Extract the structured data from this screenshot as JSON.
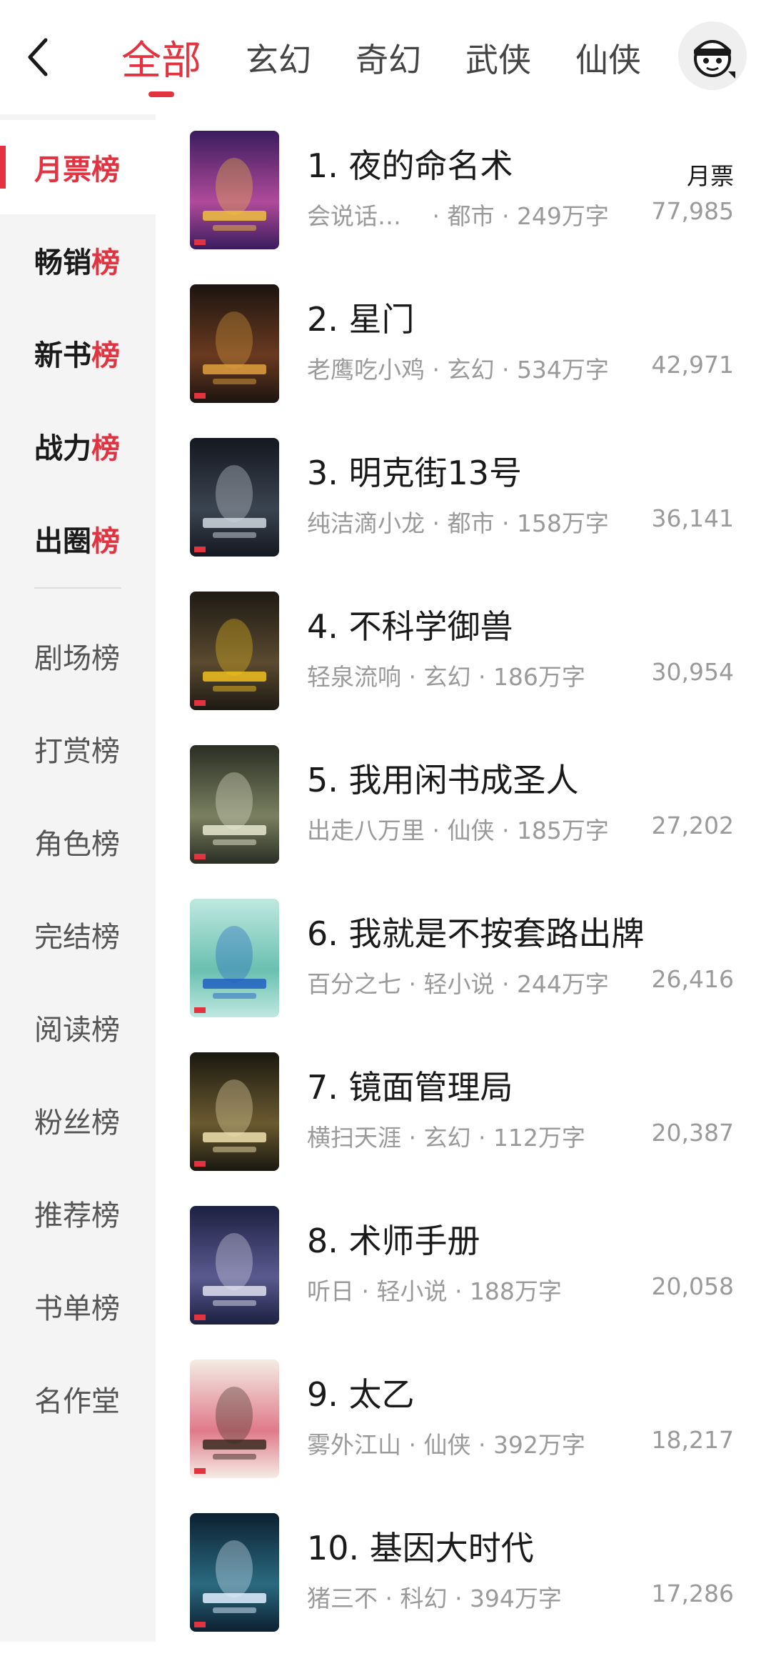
{
  "header": {
    "tabs": [
      {
        "label": "全部",
        "active": true
      },
      {
        "label": "玄幻"
      },
      {
        "label": "奇幻"
      },
      {
        "label": "武侠"
      },
      {
        "label": "仙侠"
      }
    ]
  },
  "sidebar": {
    "items": [
      {
        "pre": "月票",
        "suf": "榜",
        "style": "active"
      },
      {
        "pre": "畅销",
        "suf": "榜",
        "style": "primary"
      },
      {
        "pre": "新书",
        "suf": "榜",
        "style": "primary"
      },
      {
        "pre": "战力",
        "suf": "榜",
        "style": "primary"
      },
      {
        "pre": "出圈",
        "suf": "榜",
        "style": "primary"
      },
      {
        "pre": "剧场榜",
        "suf": "",
        "style": "normal"
      },
      {
        "pre": "打赏榜",
        "suf": "",
        "style": "normal"
      },
      {
        "pre": "角色榜",
        "suf": "",
        "style": "normal"
      },
      {
        "pre": "完结榜",
        "suf": "",
        "style": "normal"
      },
      {
        "pre": "阅读榜",
        "suf": "",
        "style": "normal"
      },
      {
        "pre": "粉丝榜",
        "suf": "",
        "style": "normal"
      },
      {
        "pre": "推荐榜",
        "suf": "",
        "style": "normal"
      },
      {
        "pre": "书单榜",
        "suf": "",
        "style": "normal"
      },
      {
        "pre": "名作堂",
        "suf": "",
        "style": "normal"
      }
    ]
  },
  "list": {
    "votes_label": "月票",
    "books": [
      {
        "title": "1. 夜的命名术",
        "meta": "会说话…　 · 都市 · 249万字",
        "votes": "77,985",
        "colors": [
          "#3a1c5e",
          "#b04a9a",
          "#f0c040"
        ]
      },
      {
        "title": "2. 星门",
        "meta": "老鹰吃小鸡 · 玄幻 · 534万字",
        "votes": "42,971",
        "colors": [
          "#1c1410",
          "#6a3a20",
          "#e0a040"
        ]
      },
      {
        "title": "3. 明克街13号",
        "meta": "纯洁滴小龙 · 都市 · 158万字",
        "votes": "36,141",
        "colors": [
          "#141820",
          "#3a4450",
          "#d0d8e0"
        ]
      },
      {
        "title": "4. 不科学御兽",
        "meta": "轻泉流响 · 玄幻 · 186万字",
        "votes": "30,954",
        "colors": [
          "#1e1a14",
          "#5a4a30",
          "#f0c020"
        ]
      },
      {
        "title": "5. 我用闲书成圣人",
        "meta": "出走八万里 · 仙侠 · 185万字",
        "votes": "27,202",
        "colors": [
          "#2a2e24",
          "#7a8060",
          "#e8e8d0"
        ]
      },
      {
        "title": "6. 我就是不按套路出牌",
        "meta": "百分之七 · 轻小说 · 244万字",
        "votes": "26,416",
        "colors": [
          "#bfe8e0",
          "#6ac0b0",
          "#2060c0"
        ]
      },
      {
        "title": "7. 镜面管理局",
        "meta": "横扫天涯 · 玄幻 · 112万字",
        "votes": "20,387",
        "colors": [
          "#1a1810",
          "#6a5a30",
          "#f0e0b0"
        ]
      },
      {
        "title": "8. 术师手册",
        "meta": "听日 · 轻小说 · 188万字",
        "votes": "20,058",
        "colors": [
          "#1c2040",
          "#5a5a90",
          "#e0e0f0"
        ]
      },
      {
        "title": "9. 太乙",
        "meta": "雾外江山 · 仙侠 · 392万字",
        "votes": "18,217",
        "colors": [
          "#f4ece4",
          "#e07a8a",
          "#3a2a20"
        ]
      },
      {
        "title": "10. 基因大时代",
        "meta": "猪三不 · 科幻 · 394万字",
        "votes": "17,286",
        "colors": [
          "#0c2030",
          "#2a6a80",
          "#e0f0ff"
        ]
      }
    ]
  }
}
